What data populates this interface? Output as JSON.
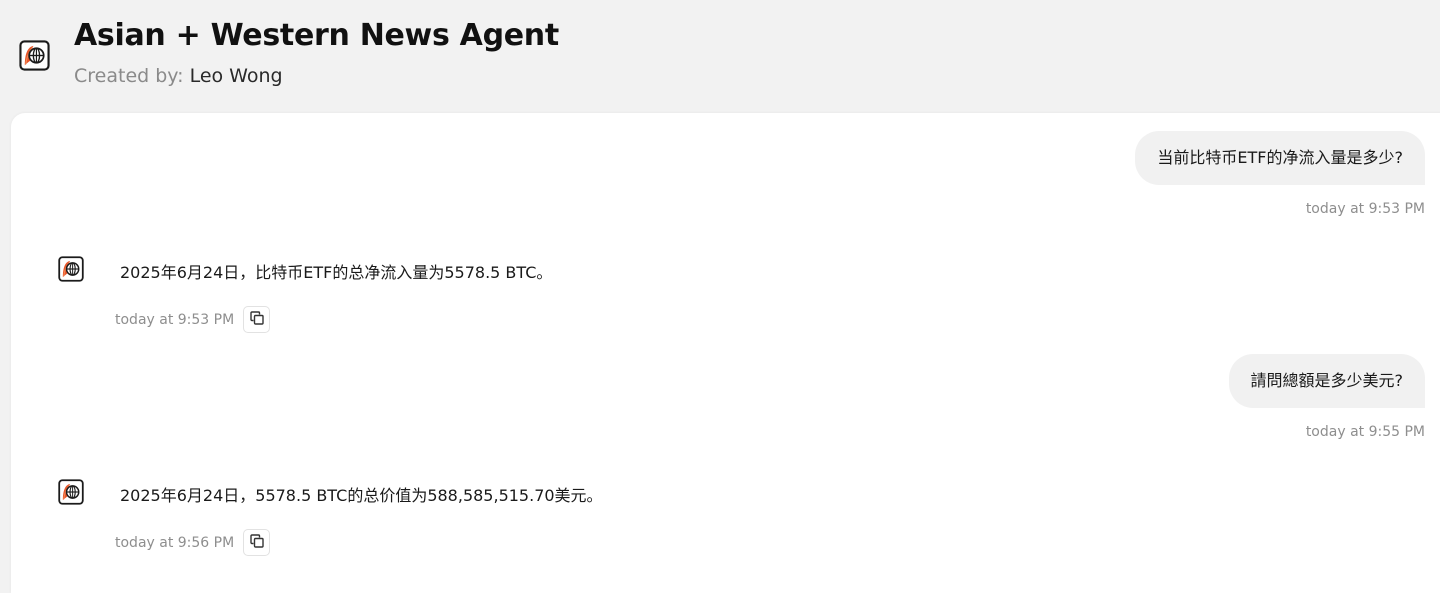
{
  "header": {
    "title": "Asian + Western News Agent",
    "created_by_label": "Created by:",
    "creator_name": "Leo Wong",
    "logo_icon": "globe-shield-logo"
  },
  "messages": [
    {
      "role": "user",
      "text": "当前比特币ETF的净流入量是多少?",
      "time": "today at 9:53 PM"
    },
    {
      "role": "assistant",
      "text": "2025年6月24日，比特币ETF的总净流入量为5578.5 BTC。",
      "time": "today at 9:53 PM",
      "action_icon": "copy-icon"
    },
    {
      "role": "user",
      "text": "請問總額是多少美元?",
      "time": "today at 9:55 PM"
    },
    {
      "role": "assistant",
      "text": "2025年6月24日，5578.5 BTC的总价值为588,585,515.70美元。",
      "time": "today at 9:56 PM",
      "action_icon": "copy-icon"
    }
  ],
  "colors": {
    "background": "#f2f2f2",
    "panel": "#ffffff",
    "user_bubble": "#f1f1f1",
    "logo_accent": "#e8562a"
  }
}
